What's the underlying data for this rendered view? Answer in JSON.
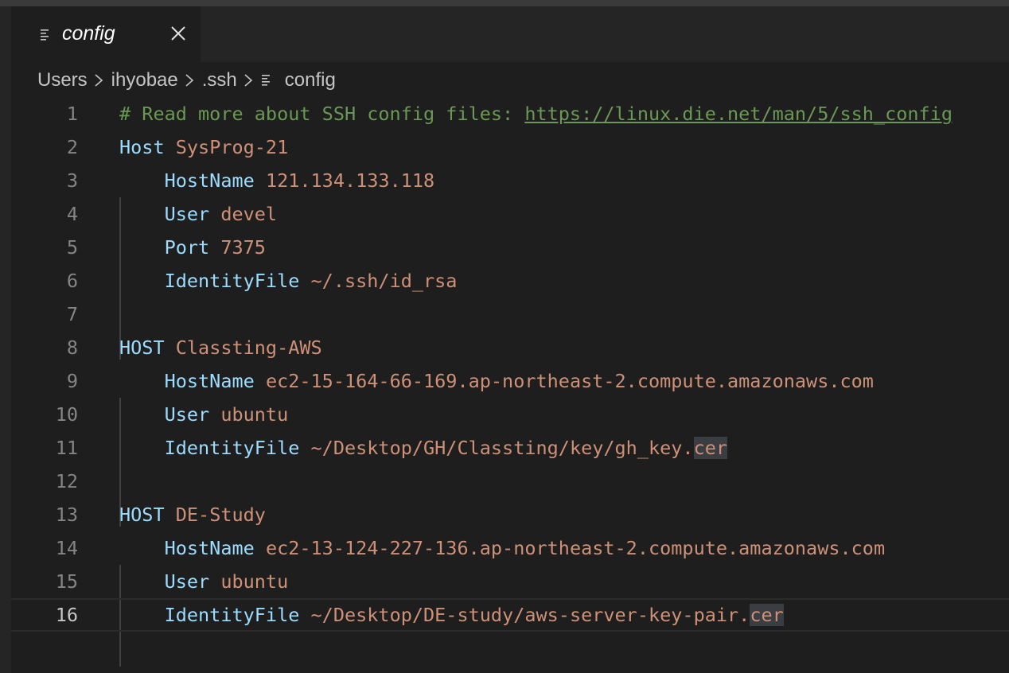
{
  "tab": {
    "label": "config"
  },
  "breadcrumb": [
    "Users",
    "ihyobae",
    ".ssh",
    "config"
  ],
  "lines": [
    {
      "n": "1",
      "comment": "# Read more about SSH config files: ",
      "url": "https://linux.die.net/man/5/ssh_config"
    },
    {
      "n": "2",
      "indent": "",
      "key": "Host",
      "value": "SysProg-21"
    },
    {
      "n": "3",
      "indent": "    ",
      "key": "HostName",
      "value": "121.134.133.118"
    },
    {
      "n": "4",
      "indent": "    ",
      "key": "User",
      "value": "devel"
    },
    {
      "n": "5",
      "indent": "    ",
      "key": "Port",
      "value": "7375"
    },
    {
      "n": "6",
      "indent": "    ",
      "key": "IdentityFile",
      "value": "~/.ssh/id_rsa"
    },
    {
      "n": "7"
    },
    {
      "n": "8",
      "indent": "",
      "key": "HOST",
      "value": "Classting-AWS"
    },
    {
      "n": "9",
      "indent": "    ",
      "key": "HostName",
      "value": "ec2-15-164-66-169.ap-northeast-2.compute.amazonaws.com"
    },
    {
      "n": "10",
      "indent": "    ",
      "key": "User",
      "value": "ubuntu"
    },
    {
      "n": "11",
      "indent": "    ",
      "key": "IdentityFile",
      "value": "~/Desktop/GH/Classting/key/gh_key.",
      "hl": "cer"
    },
    {
      "n": "12"
    },
    {
      "n": "13",
      "indent": "",
      "key": "HOST",
      "value": "DE-Study"
    },
    {
      "n": "14",
      "indent": "    ",
      "key": "HostName",
      "value": "ec2-13-124-227-136.ap-northeast-2.compute.amazonaws.com"
    },
    {
      "n": "15",
      "indent": "    ",
      "key": "User",
      "value": "ubuntu"
    },
    {
      "n": "16",
      "indent": "    ",
      "key": "IdentityFile",
      "value": "~/Desktop/DE-study/aws-server-key-pair.",
      "hl": "cer",
      "current": true
    }
  ],
  "colors": {
    "keyword": "#9cdcfe",
    "value": "#ce9178",
    "comment": "#6a9955",
    "background": "#1e1e1e"
  },
  "icons": {
    "tab": "file-lines-icon",
    "close": "close-icon",
    "breadcrumb_separator": "chevron-right-icon",
    "breadcrumb_file": "file-lines-icon"
  }
}
